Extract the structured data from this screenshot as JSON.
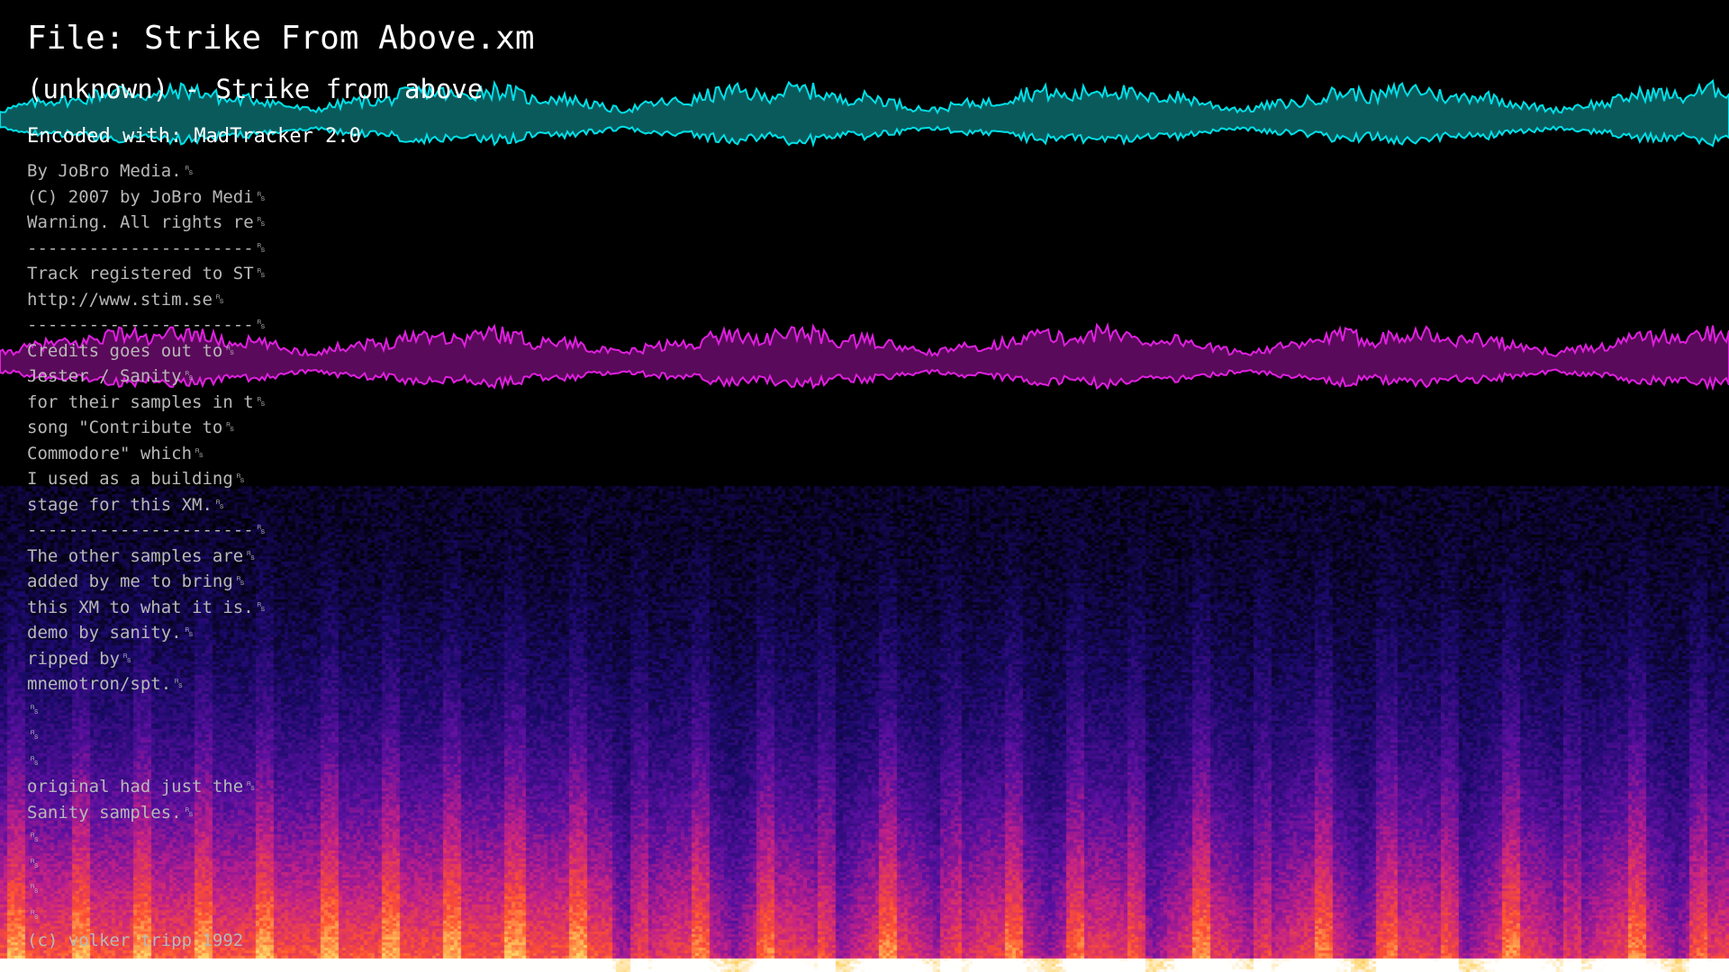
{
  "file_label": "File: Strike From Above.xm",
  "artist_title": "(unknown) - Strike from above",
  "encoder": "Encoded with: MadTracker 2.0",
  "comment_lines": [
    "By JoBro Media.␞",
    "(C) 2007 by JoBro Medi␞",
    "Warning. All rights re␞",
    "----------------------␞",
    "Track registered to ST␞",
    "http://www.stim.se␞",
    "----------------------␞",
    "Credits goes out to␞",
    "Jester / Sanity␞",
    "for their samples in t␞",
    "song \"Contribute to␞",
    "Commodore\" which␞",
    "I used as a building␞",
    "stage for this XM.␞",
    "----------------------␞",
    "The other samples are␞",
    "added by me to bring␞",
    "this XM to what it is.␞",
    "demo by sanity.␞",
    "ripped by␞",
    "mnemotron/spt.␞",
    "␞",
    "␞",
    "␞",
    "original had just the␞",
    "Sanity samples.␞",
    "␞",
    "␞",
    "␞",
    "␞",
    "(c) volker tripp 1992"
  ],
  "visualization": {
    "left_channel_color": "#00e0e8",
    "left_channel_fill": "#0a5a5c",
    "right_channel_color": "#e020e0",
    "right_channel_fill": "#5a0a5a",
    "spectrogram_palette": [
      "#000000",
      "#1a0a6a",
      "#5a10a0",
      "#c0208a",
      "#ff5030",
      "#ffd060",
      "#ffffff"
    ]
  }
}
